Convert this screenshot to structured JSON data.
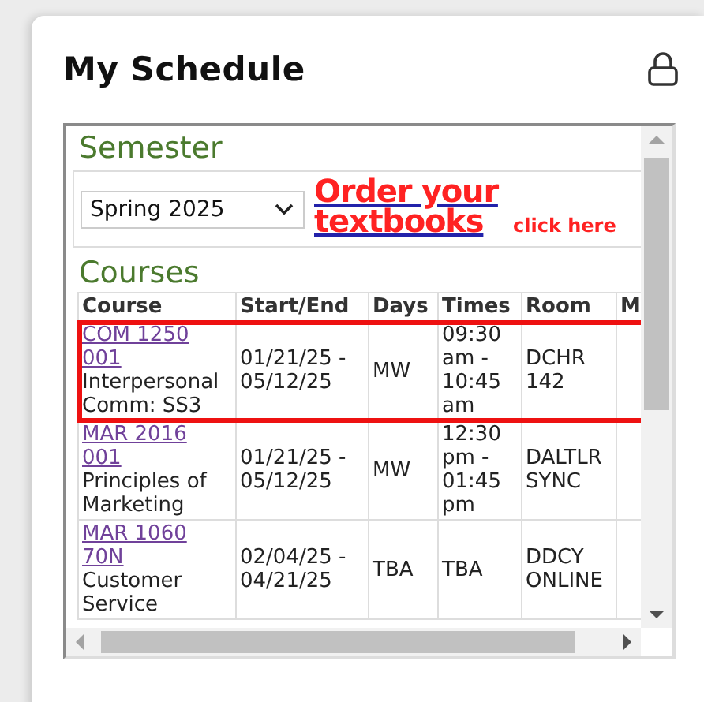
{
  "card": {
    "title": "My Schedule"
  },
  "semester": {
    "label": "Semester",
    "select": "Spring 2025",
    "textbooks_link": "Order your textbooks",
    "click_here": "click here"
  },
  "courses": {
    "label": "Courses",
    "columns": [
      "Course",
      "Start/End",
      "Days",
      "Times",
      "Room",
      "M"
    ],
    "rows": [
      {
        "code": "COM 1250",
        "section": "001",
        "name": "Interpersonal Comm: SS3",
        "dates": "01/21/25 - 05/12/25",
        "days": "MW",
        "times": "09:30 am - 10:45 am",
        "room": "DCHR 142",
        "selected": true
      },
      {
        "code": "MAR 2016",
        "section": "001",
        "name": "Principles of Marketing",
        "dates": "01/21/25 - 05/12/25",
        "days": "MW",
        "times": "12:30 pm - 01:45 pm",
        "room": "DALTLR SYNC",
        "selected": false
      },
      {
        "code": "MAR 1060",
        "section": "70N",
        "name": "Customer Service",
        "dates": "02/04/25 - 04/21/25",
        "days": "TBA",
        "times": "TBA",
        "room": "DDCY ONLINE",
        "selected": false
      }
    ]
  }
}
